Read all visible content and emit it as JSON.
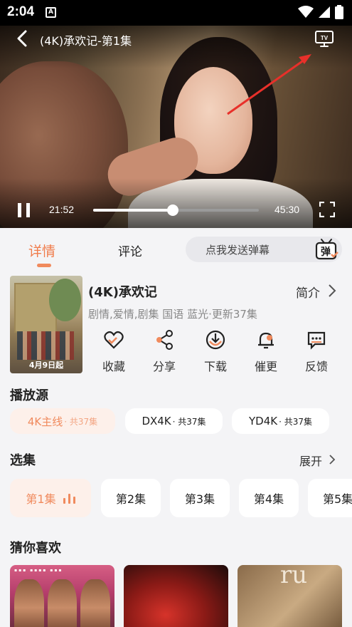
{
  "status_bar": {
    "time": "2:04",
    "app_icon_letter": "A"
  },
  "player": {
    "title": "(4K)承欢记-第1集",
    "current_time": "21:52",
    "total_time": "45:30",
    "progress_fraction": 0.48,
    "icons": [
      "back-icon",
      "tv-cast-icon",
      "pause-icon",
      "fullscreen-icon"
    ]
  },
  "tabs": {
    "detail": "详情",
    "comments": "评论"
  },
  "danmaku": {
    "placeholder": "点我发送弹幕",
    "icon_text": "弹"
  },
  "info": {
    "poster_date": "4月9日起",
    "title": "(4K)承欢记",
    "intro_label": "简介",
    "meta": "剧情,爱情,剧集 国语 蓝光·更新37集"
  },
  "actions": [
    {
      "label": "收藏",
      "icon": "heart-icon"
    },
    {
      "label": "分享",
      "icon": "share-icon"
    },
    {
      "label": "下载",
      "icon": "download-icon"
    },
    {
      "label": "催更",
      "icon": "bell-icon"
    },
    {
      "label": "反馈",
      "icon": "feedback-icon"
    }
  ],
  "sources": {
    "title": "播放源",
    "items": [
      {
        "name": "4K主线",
        "count": "· 共37集"
      },
      {
        "name": "DX4K",
        "count": "· 共37集"
      },
      {
        "name": "YD4K",
        "count": "· 共37集"
      }
    ]
  },
  "episodes": {
    "title": "选集",
    "expand_label": "展开",
    "items": [
      "第1集",
      "第2集",
      "第3集",
      "第4集",
      "第5集"
    ]
  },
  "recommend": {
    "title": "猜你喜欢",
    "rec3_text": "ru"
  },
  "colors": {
    "accent": "#f08a5d",
    "accent_bg": "#fdf0ea",
    "arrow": "#e8302a"
  }
}
